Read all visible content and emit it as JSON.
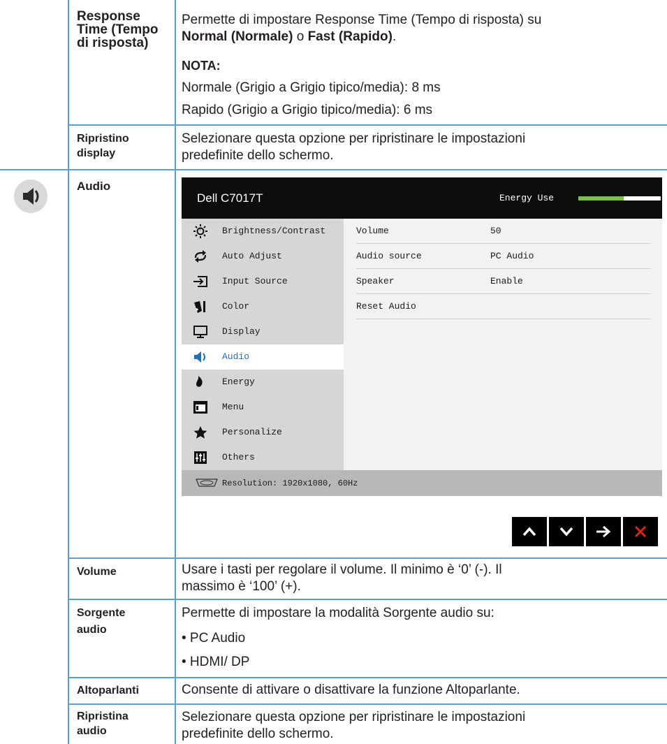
{
  "rows": {
    "response_time": {
      "label": "Response Time (Tempo di risposta)",
      "line1_pre": "Permette di impostare Response Time (Tempo di risposta) su",
      "opt_normal": "Normal (Normale)",
      "conj": "o",
      "opt_fast": "Fast (Rapido)",
      "period": ".",
      "nota": "NOTA:",
      "note1": "Normale (Grigio a Grigio tipico/media): 8 ms",
      "note2": "Rapido (Grigio a Grigio tipico/media): 6 ms"
    },
    "reset_display": {
      "label_line1": "Ripristino",
      "label_line2": "display",
      "desc_line1": "Selezionare questa opzione per ripristinare le impostazioni",
      "desc_line2": "predefinite dello schermo."
    },
    "audio": {
      "label": "Audio",
      "icon": "speaker-icon"
    },
    "volume": {
      "label": "Volume",
      "desc_line1": "Usare i tasti per regolare il volume. Il minimo è ‘0’ (-). Il",
      "desc_line2": "massimo è ‘100’ (+)."
    },
    "audio_source": {
      "label_line1": "Sorgente",
      "label_line2": "audio",
      "desc": "Permette di impostare la modalità Sorgente audio su:",
      "options": [
        "• PC Audio",
        "• HDMI/ DP"
      ]
    },
    "speakers": {
      "label": "Altoparlanti",
      "desc": "Consente di attivare o disattivare la funzione Altoparlante."
    },
    "reset_audio": {
      "label_line1": "Ripristina",
      "label_line2": "audio",
      "desc_line1": "Selezionare questa opzione per ripristinare le impostazioni",
      "desc_line2": "predefinite dello schermo."
    }
  },
  "osd": {
    "title": "Dell C7017T",
    "energy_label": "Energy Use",
    "energy_level": 0.55,
    "menu": [
      {
        "label": "Brightness/Contrast",
        "icon": "brightness-icon"
      },
      {
        "label": "Auto Adjust",
        "icon": "auto-adjust-icon"
      },
      {
        "label": "Input Source",
        "icon": "input-source-icon"
      },
      {
        "label": "Color",
        "icon": "color-icon"
      },
      {
        "label": "Display",
        "icon": "display-icon"
      },
      {
        "label": "Audio",
        "icon": "audio-icon",
        "selected": true
      },
      {
        "label": "Energy",
        "icon": "energy-icon"
      },
      {
        "label": "Menu",
        "icon": "menu-icon"
      },
      {
        "label": "Personalize",
        "icon": "star-icon"
      },
      {
        "label": "Others",
        "icon": "others-icon"
      }
    ],
    "settings": [
      {
        "name": "Volume",
        "value": "50"
      },
      {
        "name": "Audio source",
        "value": "PC Audio"
      },
      {
        "name": "Speaker",
        "value": "Enable"
      },
      {
        "name": "Reset Audio",
        "value": ""
      }
    ],
    "footer": "Resolution: 1920x1080, 60Hz",
    "nav_buttons": [
      "up-arrow-icon",
      "down-arrow-icon",
      "right-arrow-icon",
      "close-icon"
    ],
    "colors": {
      "accent": "#1f6fb2",
      "energy_fill": "#7bc142",
      "close": "#e0201b"
    }
  }
}
